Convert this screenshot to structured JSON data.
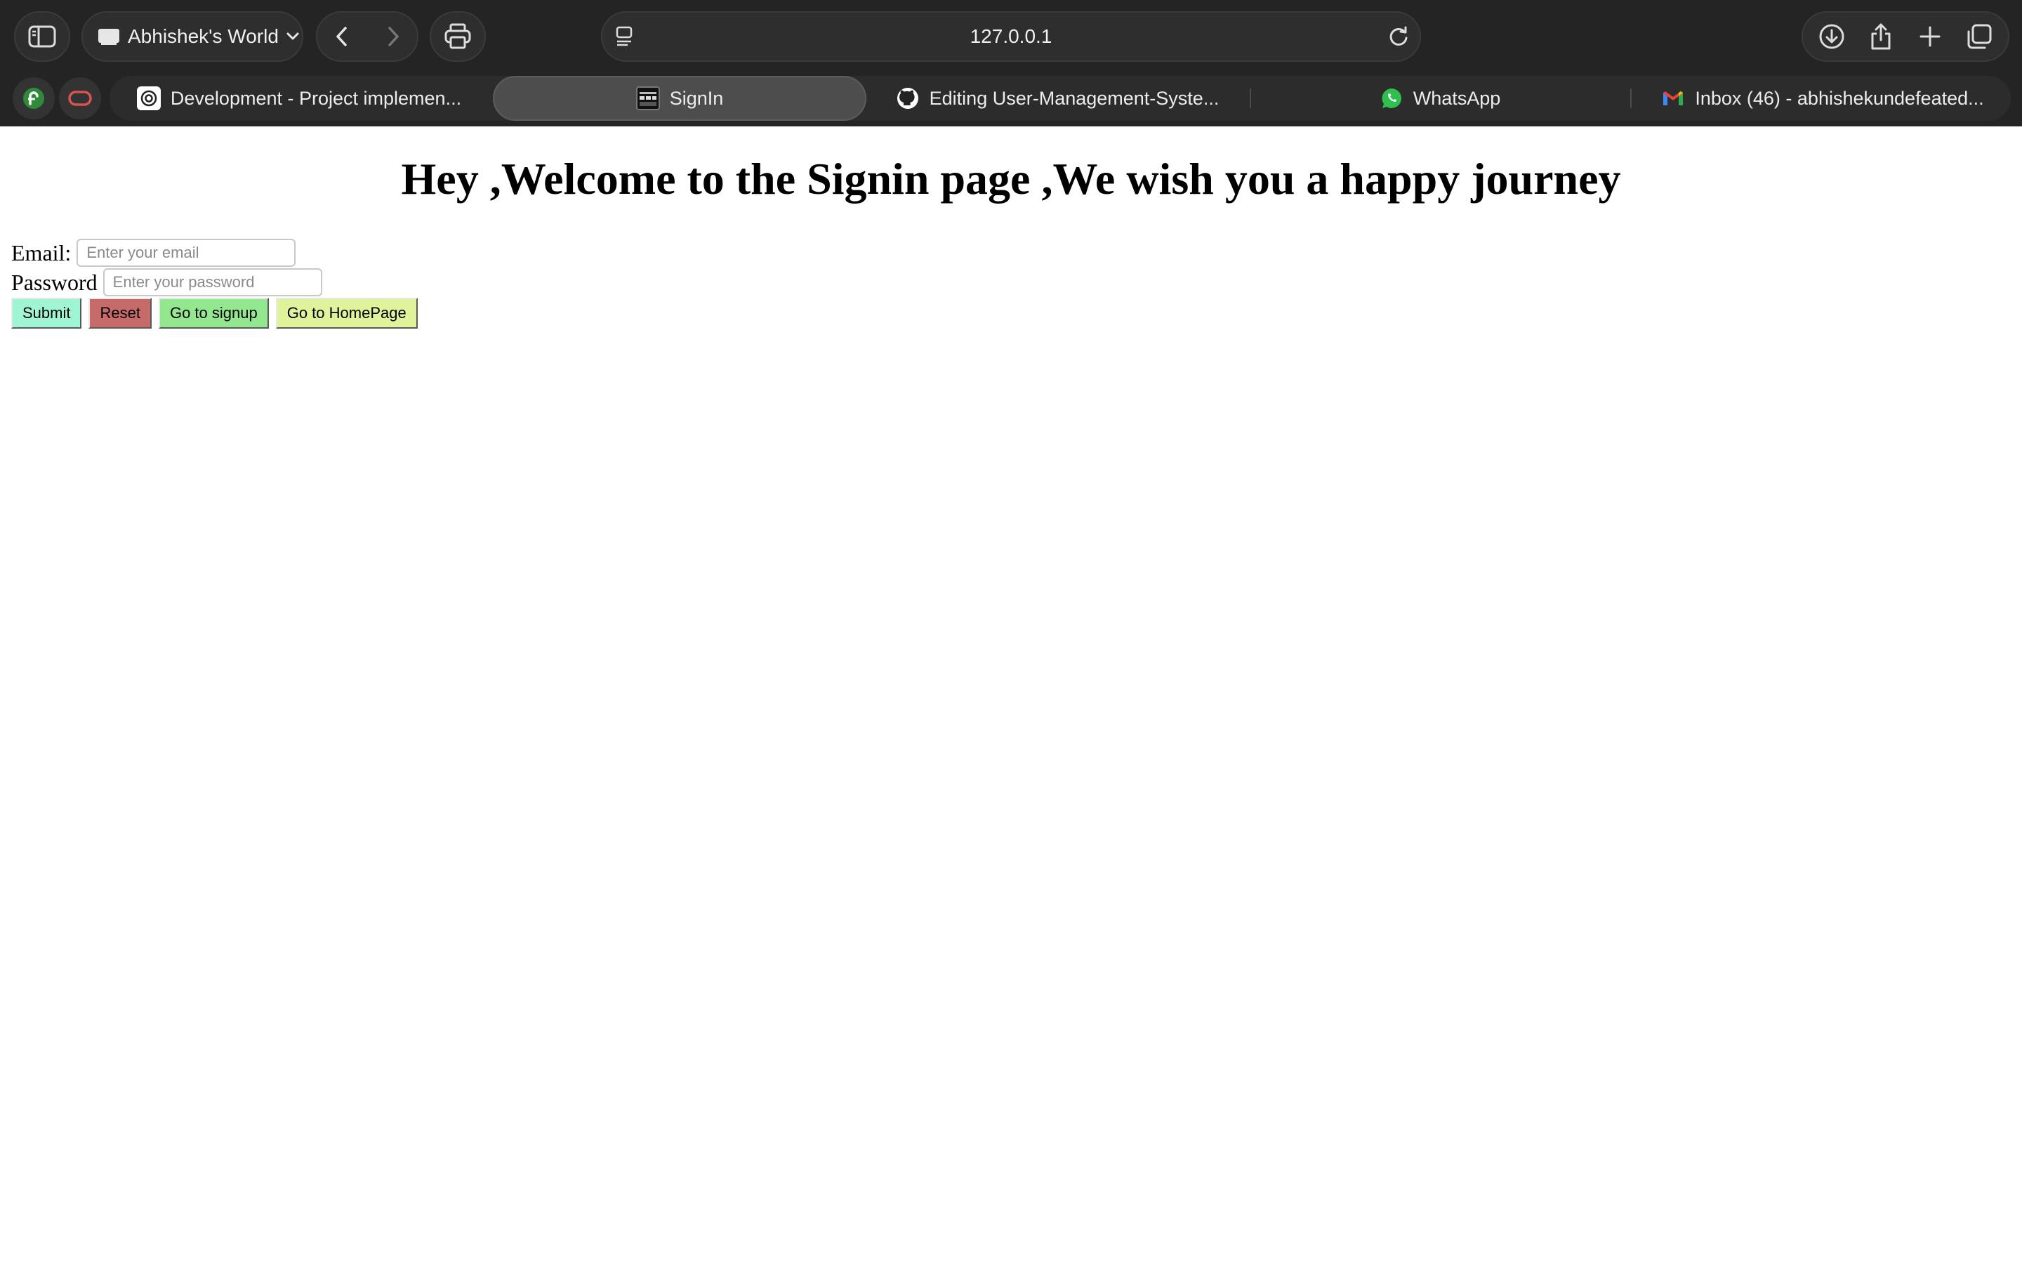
{
  "browser": {
    "profile_name": "Abhishek's World",
    "url": "127.0.0.1",
    "tabs": [
      {
        "title": "Development - Project implemen...",
        "icon": "chatgpt-icon",
        "active": false
      },
      {
        "title": "SignIn",
        "icon": "site-favicon",
        "active": true
      },
      {
        "title": "Editing User-Management-Syste...",
        "icon": "github-icon",
        "active": false
      },
      {
        "title": "WhatsApp",
        "icon": "whatsapp-icon",
        "active": false
      },
      {
        "title": "Inbox (46) - abhishekundefeated...",
        "icon": "gmail-icon",
        "active": false
      }
    ],
    "extensions": [
      {
        "icon": "green-extension-icon",
        "color": "#2f8a3a"
      },
      {
        "icon": "red-extension-icon",
        "color": "#d9534f"
      }
    ]
  },
  "page": {
    "heading": "Hey ,Welcome to the Signin page ,We wish you a happy journey",
    "email_label": "Email:",
    "email_placeholder": "Enter your email",
    "password_label": "Password",
    "password_placeholder": "Enter your password",
    "buttons": {
      "submit": {
        "label": "Submit",
        "color": "#9ff5d2"
      },
      "reset": {
        "label": "Reset",
        "color": "#c66a6a"
      },
      "signup": {
        "label": "Go to signup",
        "color": "#93e88f"
      },
      "homepage": {
        "label": "Go to HomePage",
        "color": "#dff39a"
      }
    }
  }
}
